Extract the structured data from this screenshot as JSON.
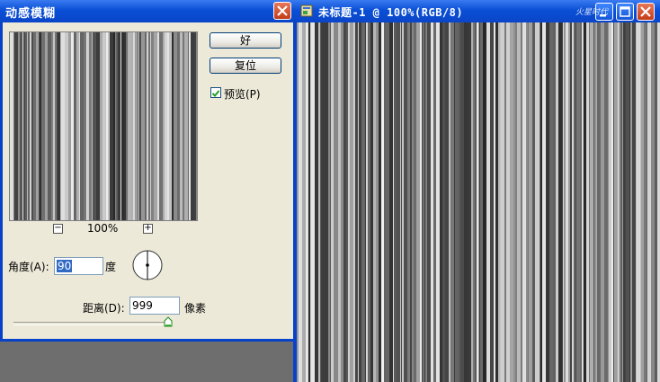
{
  "dialog": {
    "title": "动感模糊",
    "ok_label": "好",
    "reset_label": "复位",
    "preview_label": "预览(P)",
    "preview_checked": true,
    "zoom_minus": "−",
    "zoom_plus": "+",
    "zoom_level": "100%",
    "angle_label": "角度(A):",
    "angle_value": "90",
    "angle_unit": "度",
    "distance_label": "距离(D):",
    "distance_value": "999",
    "distance_unit": "像素",
    "close_icon": "close-icon",
    "dial_icon": "angle-dial-icon",
    "slider_icon": "slider-thumb-icon"
  },
  "document": {
    "title": "未标题-1 @ 100%(RGB/8)",
    "icons": [
      "document-icon",
      "minimize-icon",
      "maximize-icon",
      "close-icon"
    ]
  },
  "watermark": "火星时代",
  "colors": {
    "titlebar": "#0a4fd6",
    "dialog_bg": "#ece9d8",
    "close_red": "#d0512c",
    "selection": "#316ac5"
  }
}
